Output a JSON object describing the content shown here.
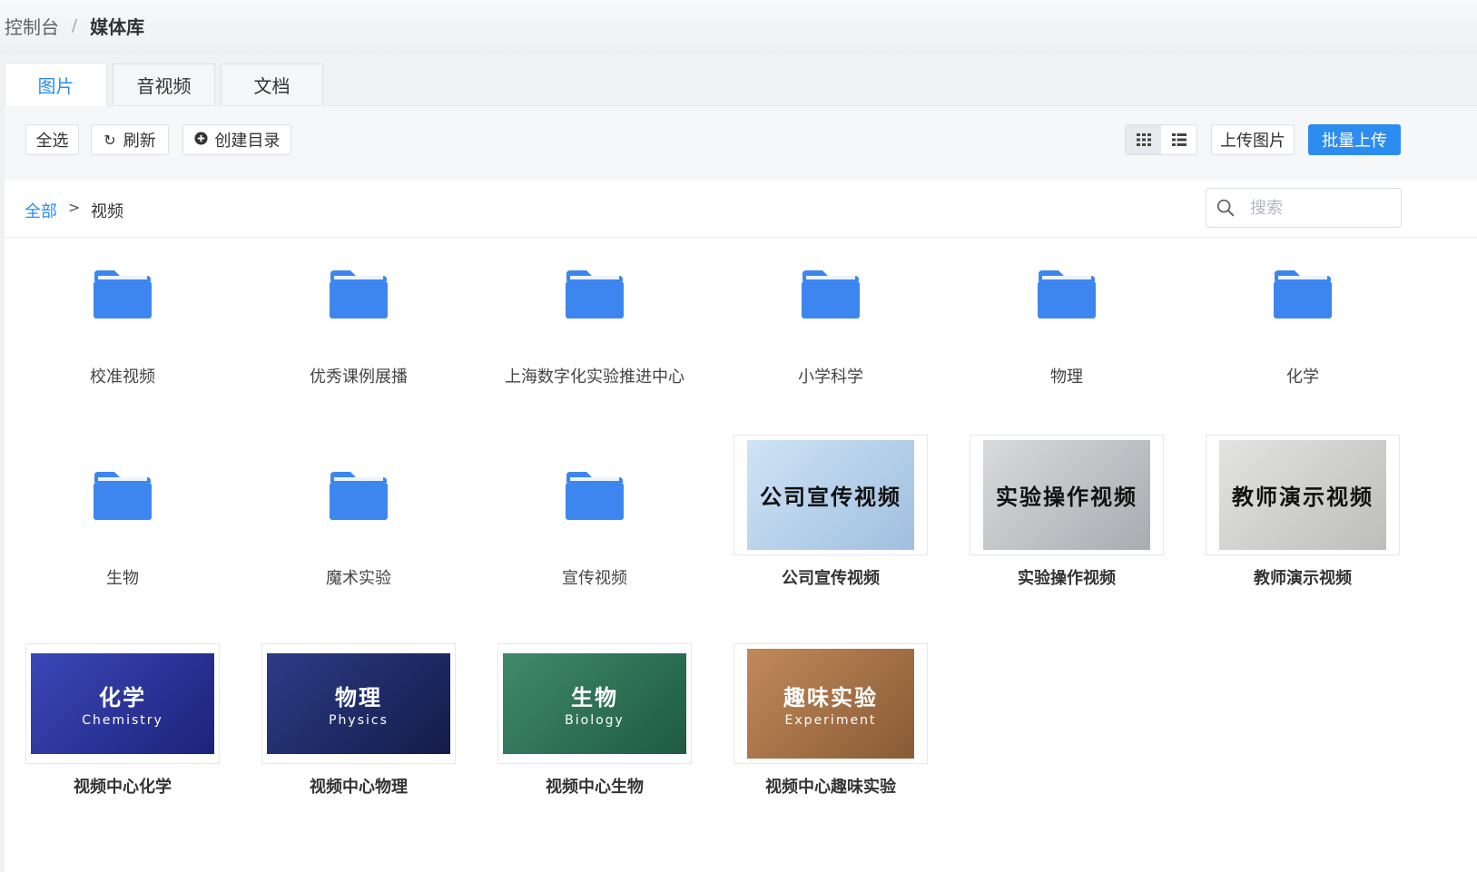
{
  "breadcrumb_top": {
    "root": "控制台",
    "separator": "/",
    "current": "媒体库"
  },
  "tabs": [
    {
      "label": "图片"
    },
    {
      "label": "音视频"
    },
    {
      "label": "文档"
    }
  ],
  "toolbar": {
    "select_all": "全选",
    "refresh": "刷新",
    "create_dir": "创建目录",
    "upload_image": "上传图片",
    "batch_upload": "批量上传"
  },
  "path": {
    "root": "全部",
    "separator": ">",
    "current": "视频"
  },
  "search": {
    "placeholder": "搜索",
    "value": ""
  },
  "folders": [
    {
      "name": "校准视频"
    },
    {
      "name": "优秀课例展播"
    },
    {
      "name": "上海数字化实验推进中心"
    },
    {
      "name": "小学科学"
    },
    {
      "name": "物理"
    },
    {
      "name": "化学"
    },
    {
      "name": "生物"
    },
    {
      "name": "魔术实验"
    },
    {
      "name": "宣传视频"
    }
  ],
  "videos": [
    {
      "name": "公司宣传视频",
      "thumb_title": "公司宣传视频",
      "thumb_sub": "",
      "color_a": "#cfe3f5",
      "color_b": "#9fbfe0",
      "text_color": "#111111"
    },
    {
      "name": "实验操作视频",
      "thumb_title": "实验操作视频",
      "thumb_sub": "",
      "color_a": "#d9dadd",
      "color_b": "#a9abb0",
      "text_color": "#111111"
    },
    {
      "name": "教师演示视频",
      "thumb_title": "教师演示视频",
      "thumb_sub": "",
      "color_a": "#e3e3e1",
      "color_b": "#bdbebb",
      "text_color": "#111111"
    },
    {
      "name": "视频中心化学",
      "thumb_title": "化学",
      "thumb_sub": "Chemistry",
      "color_a": "#3b47b8",
      "color_b": "#1c237a",
      "text_color": "#ffffff"
    },
    {
      "name": "视频中心物理",
      "thumb_title": "物理",
      "thumb_sub": "Physics",
      "color_a": "#2c3c86",
      "color_b": "#141c4a",
      "text_color": "#ffffff"
    },
    {
      "name": "视频中心生物",
      "thumb_title": "生物",
      "thumb_sub": "Biology",
      "color_a": "#3f8a6a",
      "color_b": "#1f5a44",
      "text_color": "#ffffff"
    },
    {
      "name": "视频中心趣味实验",
      "thumb_title": "趣味实验",
      "thumb_sub": "Experiment",
      "color_a": "#c08a5a",
      "color_b": "#8a5a35",
      "text_color": "#ffffff"
    }
  ],
  "colors": {
    "accent": "#2d8cf0",
    "folder": "#3d86f0"
  }
}
